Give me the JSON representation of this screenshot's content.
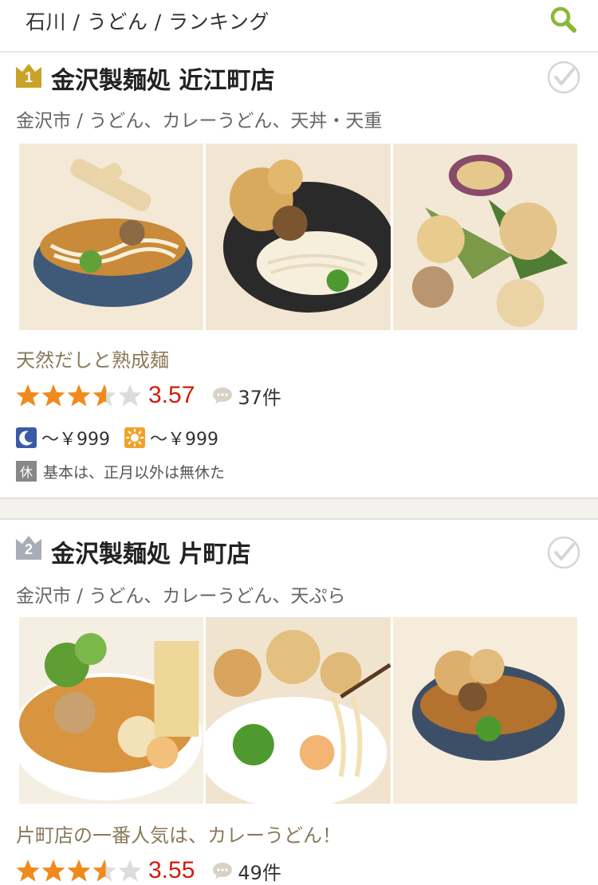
{
  "header": {
    "breadcrumb": "石川 / うどん / ランキング",
    "search_icon": "search-icon"
  },
  "colors": {
    "accent_green": "#8ab833",
    "rating_red": "#d21c08",
    "star_orange": "#f08a1c",
    "rank1_gold": "#c9a227",
    "rank2_silver": "#a8adb8"
  },
  "restaurants": [
    {
      "rank": "1",
      "name": "金沢製麺処 近江町店",
      "genre": "金沢市 / うどん、カレーうどん、天丼・天重",
      "catchphrase": "天然だしと熟成麺",
      "rating_value": 3.57,
      "rating": "3.57",
      "reviews": "37件",
      "dinner_price": "〜￥999",
      "lunch_price": "〜￥999",
      "holiday_label": "休",
      "holiday": "基本は、正月以外は無休た"
    },
    {
      "rank": "2",
      "name": "金沢製麺処 片町店",
      "genre": "金沢市 / うどん、カレーうどん、天ぷら",
      "catchphrase": "片町店の一番人気は、カレーうどん！",
      "rating_value": 3.55,
      "rating": "3.55",
      "reviews": "49件"
    }
  ]
}
